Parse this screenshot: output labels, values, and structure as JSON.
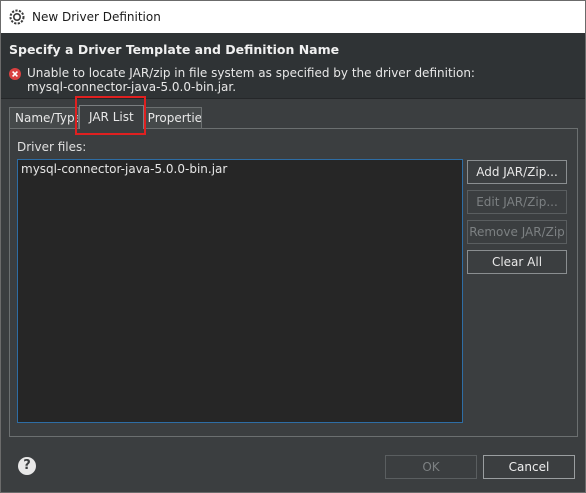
{
  "window": {
    "title": "New Driver Definition",
    "app_icon": "eclipse-gear-icon"
  },
  "banner": {
    "heading": "Specify a Driver Template and Definition Name",
    "error_icon": "error-x-icon",
    "error_line1": "Unable to locate JAR/zip in file system as specified by the driver definition:",
    "error_line2": "mysql-connector-java-5.0.0-bin.jar."
  },
  "tabs": [
    {
      "label": "Name/Type",
      "selected": false
    },
    {
      "label": "JAR List",
      "selected": true
    },
    {
      "label": "Properties",
      "selected": false
    }
  ],
  "jar_list": {
    "label": "Driver files:",
    "files": [
      "mysql-connector-java-5.0.0-bin.jar"
    ],
    "buttons": {
      "add": "Add JAR/Zip...",
      "edit": "Edit JAR/Zip...",
      "remove": "Remove JAR/Zip",
      "clear": "Clear All"
    }
  },
  "footer": {
    "help": "?",
    "ok": "OK",
    "cancel": "Cancel"
  },
  "colors": {
    "highlight": "#e02020",
    "background": "#3b3e40",
    "list_border": "#2e6da4"
  }
}
